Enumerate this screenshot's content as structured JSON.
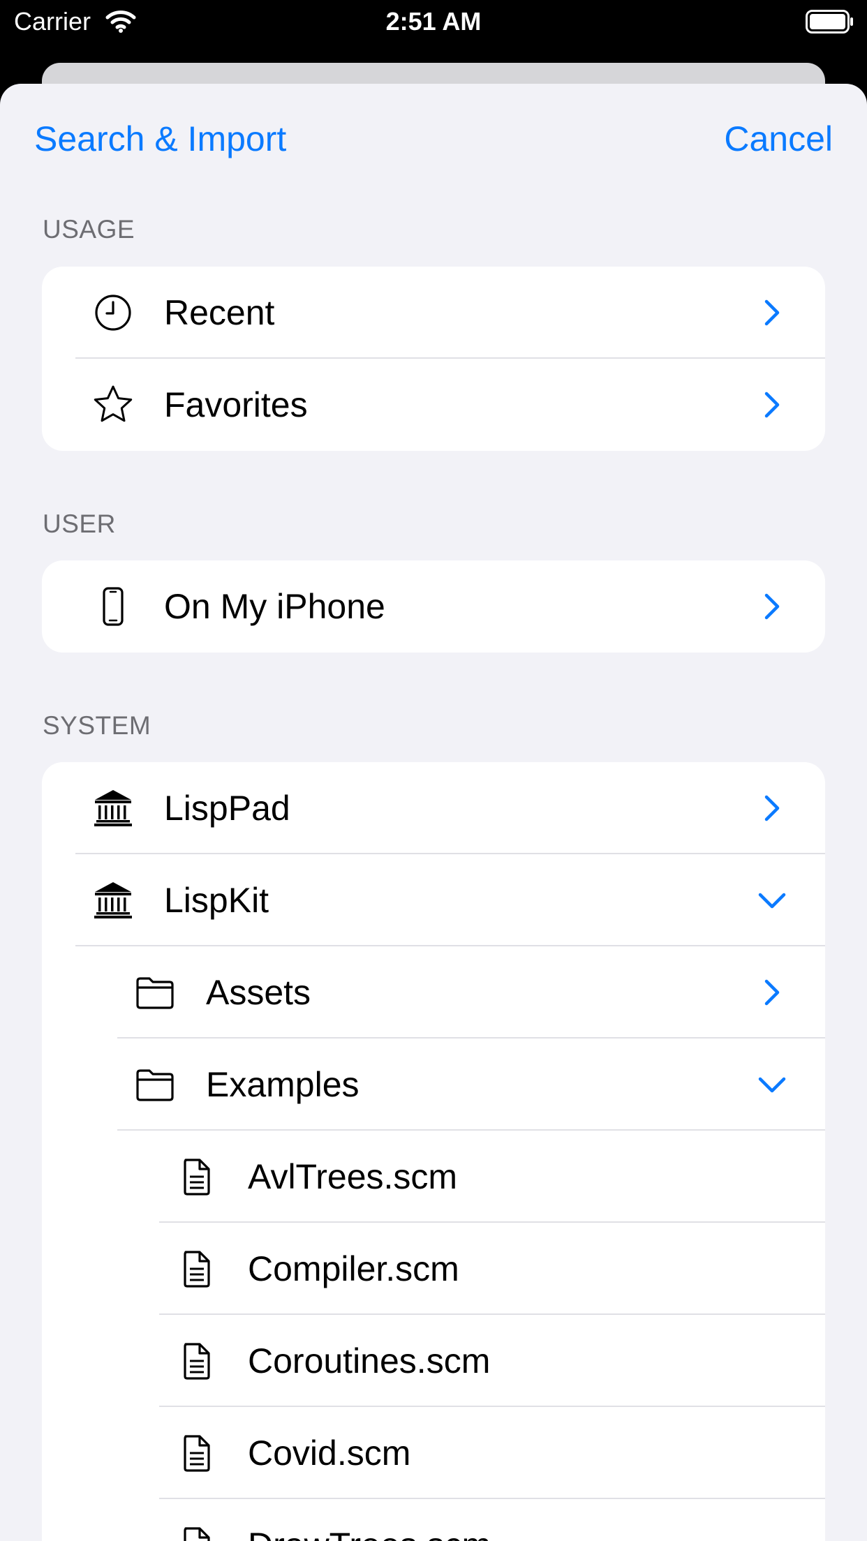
{
  "status_bar": {
    "carrier": "Carrier",
    "time": "2:51 AM"
  },
  "nav": {
    "left_title": "Search & Import",
    "right_button": "Cancel"
  },
  "sections": {
    "usage": {
      "header": "USAGE",
      "rows": [
        {
          "label": "Recent",
          "icon": "clock-icon",
          "accessory": "chevron-right"
        },
        {
          "label": "Favorites",
          "icon": "star-icon",
          "accessory": "chevron-right"
        }
      ]
    },
    "user": {
      "header": "USER",
      "rows": [
        {
          "label": "On My iPhone",
          "icon": "iphone-icon",
          "accessory": "chevron-right"
        }
      ]
    },
    "system": {
      "header": "SYSTEM",
      "rows": [
        {
          "label": "LispPad",
          "icon": "building-columns-icon",
          "accessory": "chevron-right"
        },
        {
          "label": "LispKit",
          "icon": "building-columns-icon",
          "accessory": "chevron-down"
        },
        {
          "label": "Assets",
          "icon": "folder-icon",
          "accessory": "chevron-right"
        },
        {
          "label": "Examples",
          "icon": "folder-icon",
          "accessory": "chevron-down"
        },
        {
          "label": "AvlTrees.scm",
          "icon": "document-icon"
        },
        {
          "label": "Compiler.scm",
          "icon": "document-icon"
        },
        {
          "label": "Coroutines.scm",
          "icon": "document-icon"
        },
        {
          "label": "Covid.scm",
          "icon": "document-icon"
        },
        {
          "label": "DrawTrees.scm",
          "icon": "document-icon"
        }
      ]
    }
  },
  "colors": {
    "accent": "#0a7aff",
    "background": "#f2f2f7",
    "header_text": "#6d6d72"
  }
}
